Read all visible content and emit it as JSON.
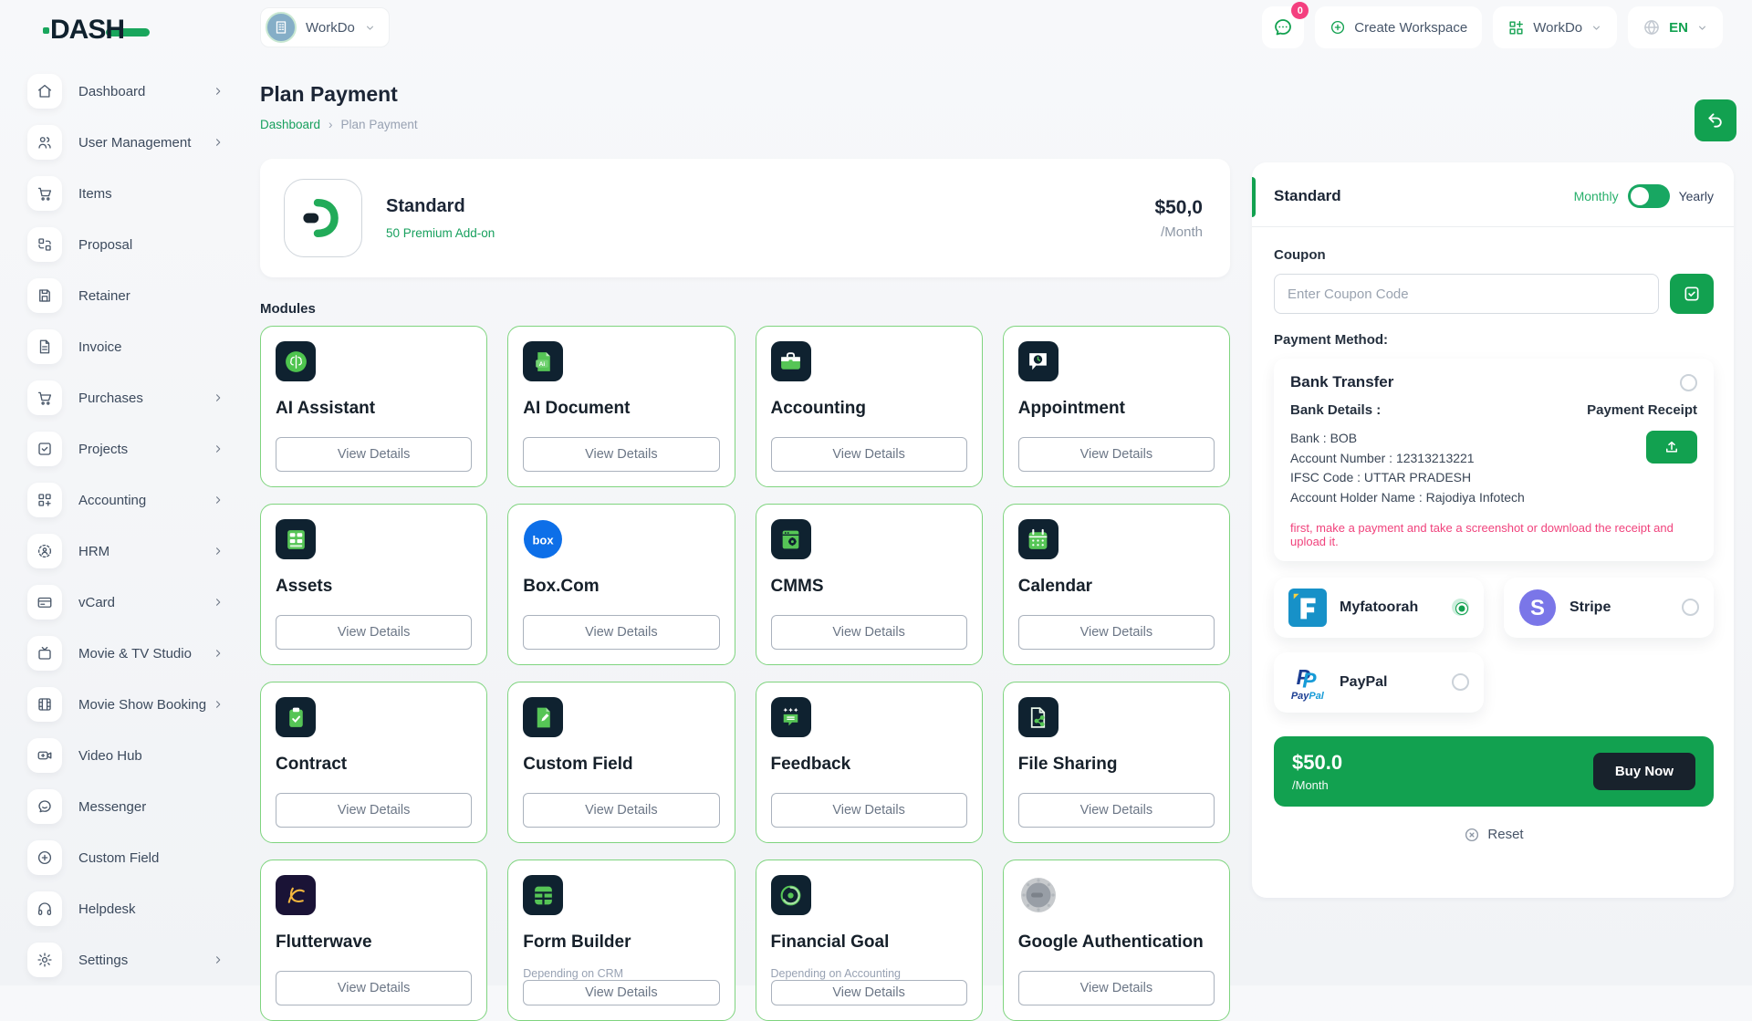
{
  "colors": {
    "primary": "#12a150",
    "dark_tile": "#0f2230",
    "card_border": "#7fd47f",
    "pink": "#f43f7f"
  },
  "app": {
    "logo_text": "DASH"
  },
  "header": {
    "workspace": {
      "label": "WorkDo",
      "icon": "building-icon"
    },
    "chat": {
      "badge": "0",
      "icon": "chat-icon"
    },
    "create_workspace": {
      "label": "Create Workspace",
      "icon": "plus-circle-icon"
    },
    "workdo_menu": {
      "label": "WorkDo",
      "icon": "grid-plus-icon"
    },
    "language": {
      "label": "EN",
      "icon": "globe-icon"
    }
  },
  "sidebar": {
    "items": [
      {
        "label": "Dashboard",
        "icon": "home",
        "chevron": true
      },
      {
        "label": "User Management",
        "icon": "users",
        "chevron": true
      },
      {
        "label": "Items",
        "icon": "cart",
        "chevron": false
      },
      {
        "label": "Proposal",
        "icon": "proposal",
        "chevron": false
      },
      {
        "label": "Retainer",
        "icon": "save",
        "chevron": false
      },
      {
        "label": "Invoice",
        "icon": "file-text",
        "chevron": false
      },
      {
        "label": "Purchases",
        "icon": "cart",
        "chevron": true
      },
      {
        "label": "Projects",
        "icon": "check-square",
        "chevron": true
      },
      {
        "label": "Accounting",
        "icon": "grid-plus",
        "chevron": true
      },
      {
        "label": "HRM",
        "icon": "hrm",
        "chevron": true
      },
      {
        "label": "vCard",
        "icon": "credit-card",
        "chevron": true
      },
      {
        "label": "Movie & TV Studio",
        "icon": "tv",
        "chevron": true
      },
      {
        "label": "Movie Show Booking",
        "icon": "film",
        "chevron": true
      },
      {
        "label": "Video Hub",
        "icon": "video",
        "chevron": false
      },
      {
        "label": "Messenger",
        "icon": "message",
        "chevron": false
      },
      {
        "label": "Custom Field",
        "icon": "plus-circle",
        "chevron": false
      },
      {
        "label": "Helpdesk",
        "icon": "headphones",
        "chevron": false
      },
      {
        "label": "Settings",
        "icon": "gear",
        "chevron": true
      }
    ]
  },
  "page": {
    "title": "Plan Payment",
    "breadcrumb_home": "Dashboard",
    "breadcrumb_sep": "›",
    "breadcrumb_current": "Plan Payment"
  },
  "plan_card": {
    "name": "Standard",
    "addon_link": "50 Premium Add-on",
    "price": "$50,0",
    "period": "/Month"
  },
  "modules": {
    "heading": "Modules",
    "view_details_label": "View Details",
    "cards": [
      {
        "title": "AI Assistant",
        "icon": "brain",
        "tile": true
      },
      {
        "title": "AI Document",
        "icon": "ai-doc",
        "tile": true
      },
      {
        "title": "Accounting",
        "icon": "briefcase",
        "tile": true
      },
      {
        "title": "Appointment",
        "icon": "appointment",
        "tile": true
      },
      {
        "title": "Assets",
        "icon": "calculator",
        "tile": true
      },
      {
        "title": "Box.Com",
        "icon": "box",
        "tile": false
      },
      {
        "title": "CMMS",
        "icon": "cmms",
        "tile": true
      },
      {
        "title": "Calendar",
        "icon": "calendar",
        "tile": true
      },
      {
        "title": "Contract",
        "icon": "contract",
        "tile": true
      },
      {
        "title": "Custom Field",
        "icon": "doc-pencil",
        "tile": true
      },
      {
        "title": "Feedback",
        "icon": "chat-stars",
        "tile": true
      },
      {
        "title": "File Sharing",
        "icon": "file-share",
        "tile": true
      },
      {
        "title": "Flutterwave",
        "icon": "flutterwave",
        "tile": true,
        "tile_color": "#1a1336"
      },
      {
        "title": "Form Builder",
        "icon": "form-grid",
        "tile": true,
        "note": "Depending on CRM"
      },
      {
        "title": "Financial Goal",
        "icon": "goal",
        "tile": true,
        "note": "Depending on Accounting"
      },
      {
        "title": "Google Authentication",
        "icon": "google-auth",
        "tile": false
      }
    ]
  },
  "checkout": {
    "plan_name": "Standard",
    "billing": {
      "monthly": "Monthly",
      "yearly": "Yearly"
    },
    "coupon": {
      "label": "Coupon",
      "placeholder": "Enter Coupon Code"
    },
    "payment_method_label": "Payment Method:",
    "bank_transfer": {
      "title": "Bank Transfer",
      "details_label": "Bank Details :",
      "receipt_label": "Payment Receipt",
      "lines": [
        "Bank : BOB",
        "Account Number : 12313213221",
        "IFSC Code : UTTAR PRADESH",
        "Account Holder Name : Rajodiya Infotech"
      ],
      "note": "first, make a payment and take a screenshot or download the receipt and upload it."
    },
    "methods": [
      {
        "name": "Myfatoorah",
        "logo": "myfatoorah",
        "selected": true
      },
      {
        "name": "Stripe",
        "logo": "stripe",
        "selected": false
      },
      {
        "name": "PayPal",
        "logo": "paypal",
        "selected": false
      }
    ],
    "summary": {
      "price": "$50.0",
      "period": "/Month",
      "buy_label": "Buy Now"
    },
    "reset_label": "Reset"
  }
}
